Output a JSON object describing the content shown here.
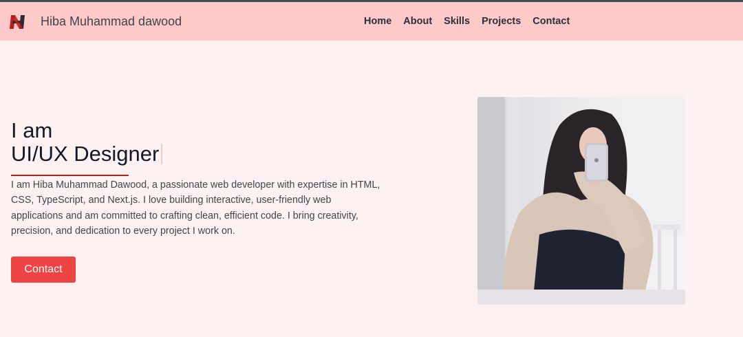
{
  "header": {
    "brand_name": "Hiba Muhammad dawood",
    "nav": [
      {
        "label": "Home"
      },
      {
        "label": "About"
      },
      {
        "label": "Skills"
      },
      {
        "label": "Projects"
      },
      {
        "label": "Contact"
      }
    ]
  },
  "hero": {
    "line1": "I am",
    "line2": "UI/UX Designer",
    "bio": "I am Hiba Muhammad Dawood, a passionate web developer with expertise in HTML, CSS, TypeScript, and Next.js. I love building interactive, user-friendly web applications and am committed to crafting clean, efficient code. I bring creativity, precision, and dedication to every project I work on.",
    "button_label": "Contact"
  },
  "colors": {
    "navbar_bg": "#fec9c9",
    "page_bg": "#fdf1f1",
    "accent": "#ef4444",
    "underline": "#b91c1c"
  },
  "icons": {
    "logo": "h-monogram-logo"
  }
}
